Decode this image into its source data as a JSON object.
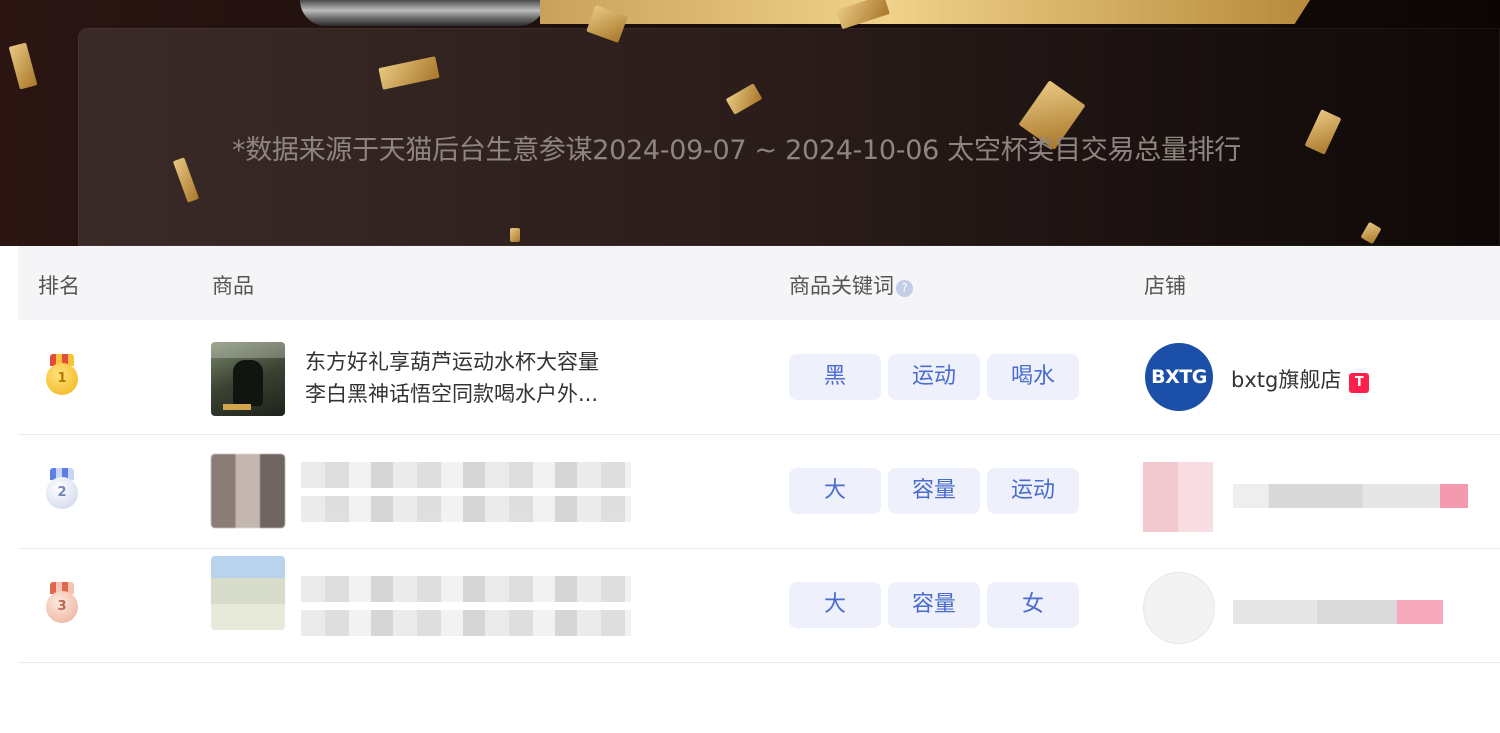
{
  "banner": {
    "note": "*数据来源于天猫后台生意参谋2024-09-07 ~ 2024-10-06 太空杯类目交易总量排行"
  },
  "table": {
    "headers": {
      "rank": "排名",
      "product": "商品",
      "keywords": "商品关键词",
      "shop": "店铺"
    },
    "rows": [
      {
        "rank": "1",
        "medal": "gold",
        "product_title_line1": "东方好礼享葫芦运动水杯大容量",
        "product_title_line2": "李白黑神话悟空同款喝水户外...",
        "keywords": [
          "黑",
          "运动",
          "喝水"
        ],
        "shop_logo_text": "BXTG",
        "shop_name": "bxtg旗舰店",
        "shop_badge": "T"
      },
      {
        "rank": "2",
        "medal": "silver",
        "keywords": [
          "大",
          "容量",
          "运动"
        ]
      },
      {
        "rank": "3",
        "medal": "bronze",
        "keywords": [
          "大",
          "容量",
          "女"
        ]
      }
    ]
  },
  "colors": {
    "tag_text": "#4a6bd0",
    "tag_bg": "#eef1fb",
    "tmall_red": "#ff1f4b",
    "shop_logo_blue": "#1b4fa8"
  }
}
